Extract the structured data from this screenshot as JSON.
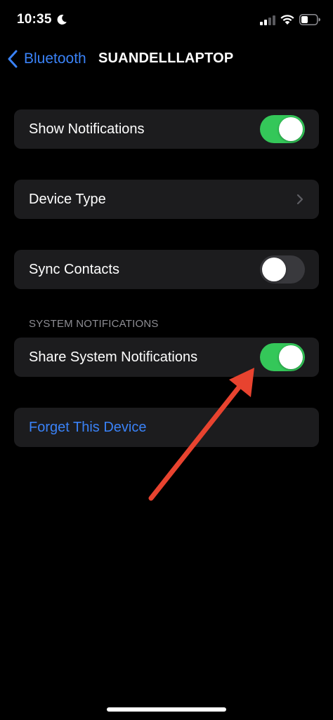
{
  "status_bar": {
    "time": "10:35",
    "icons": [
      "moon-icon",
      "cellular-signal-icon",
      "wifi-icon",
      "battery-icon"
    ]
  },
  "nav": {
    "back_label": "Bluetooth",
    "title": "SUANDELLLAPTOP"
  },
  "cells": {
    "show_notifications": {
      "label": "Show Notifications",
      "toggle_on": true
    },
    "device_type": {
      "label": "Device Type"
    },
    "sync_contacts": {
      "label": "Sync Contacts",
      "toggle_on": false
    },
    "system_notifications_header": "SYSTEM NOTIFICATIONS",
    "share_system_notifications": {
      "label": "Share System Notifications",
      "toggle_on": true
    },
    "forget_device": {
      "label": "Forget This Device"
    }
  },
  "colors": {
    "background": "#000000",
    "cell_background": "#1c1c1e",
    "accent_blue": "#3a82f7",
    "toggle_on_green": "#34c759",
    "toggle_off_gray": "#39393d",
    "annotation_arrow_red": "#e8432f"
  }
}
